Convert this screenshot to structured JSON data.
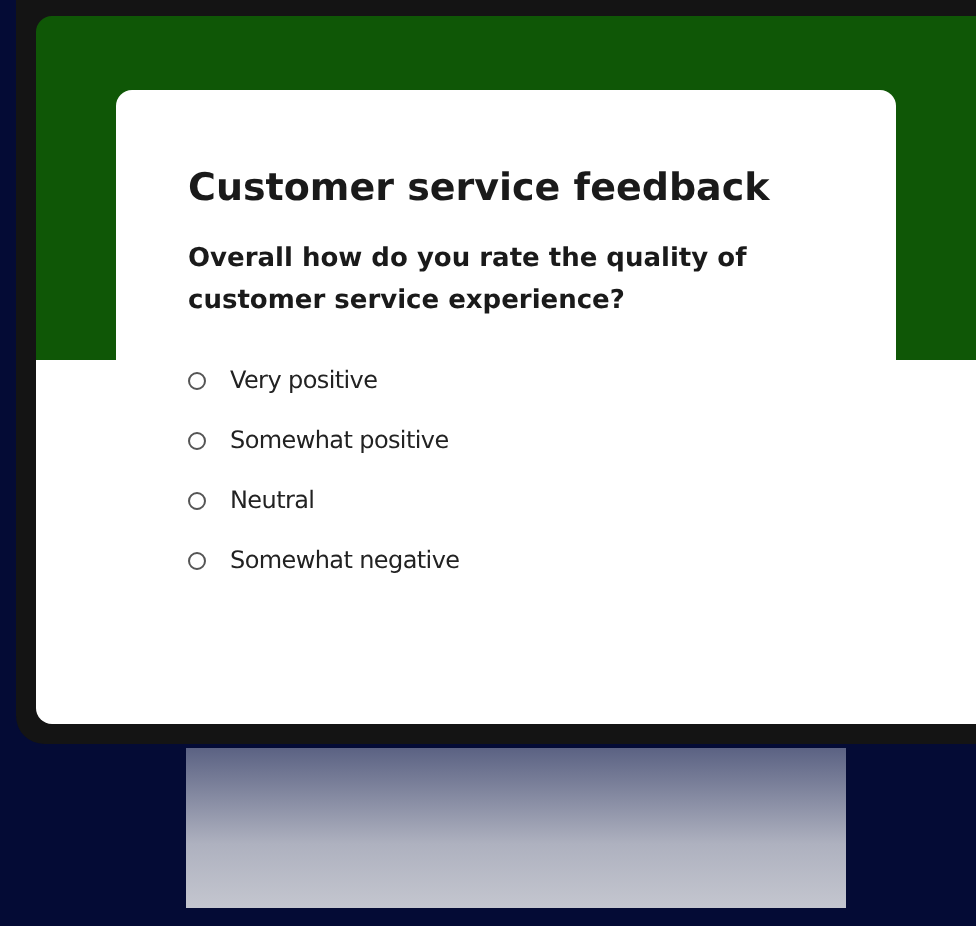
{
  "survey": {
    "title": "Customer service feedback",
    "question": "Overall how do you rate the quality of customer service experience?",
    "options": [
      {
        "label": "Very positive",
        "selected": false
      },
      {
        "label": "Somewhat positive",
        "selected": false
      },
      {
        "label": "Neutral",
        "selected": false
      },
      {
        "label": "Somewhat negative",
        "selected": false
      }
    ]
  }
}
